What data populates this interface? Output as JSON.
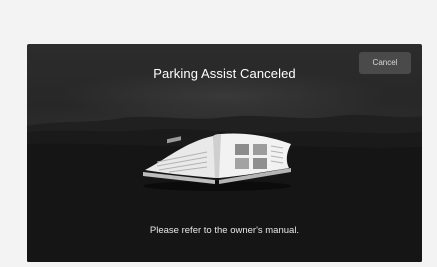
{
  "screen": {
    "title": "Parking Assist Canceled",
    "message": "Please refer to the owner's manual.",
    "cancel_label": "Cancel"
  },
  "icons": {
    "manual": "open-book-icon"
  },
  "colors": {
    "screen_background": "#1e1e1e",
    "title_text": "#ffffff",
    "button_background": "#4a4a4a"
  }
}
